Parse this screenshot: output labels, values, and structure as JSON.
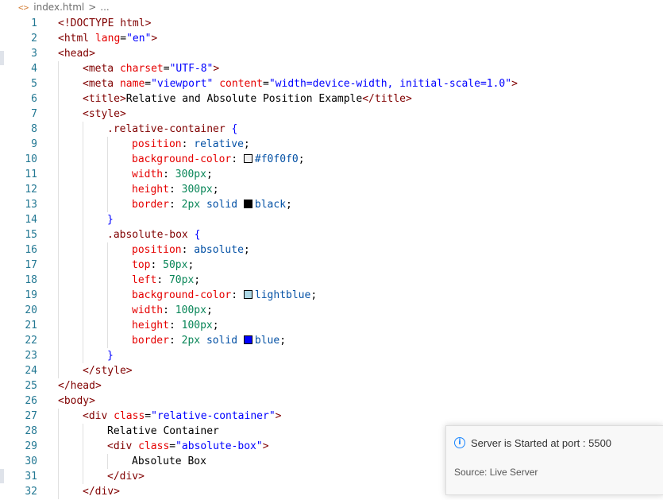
{
  "breadcrumb": {
    "icon": "<>",
    "file": "index.html",
    "separator": ">",
    "ellipsis": "..."
  },
  "lines": [
    {
      "n": "1",
      "i": 0,
      "s": [
        [
          "tag",
          "<!DOCTYPE html>"
        ]
      ]
    },
    {
      "n": "2",
      "i": 0,
      "s": [
        [
          "tag",
          "<html"
        ],
        [
          "attr",
          " lang"
        ],
        [
          "punct",
          "="
        ],
        [
          "str",
          "\"en\""
        ],
        [
          "tag",
          ">"
        ]
      ]
    },
    {
      "n": "3",
      "i": 0,
      "s": [
        [
          "tag",
          "<head>"
        ]
      ]
    },
    {
      "n": "4",
      "i": 1,
      "s": [
        [
          "tag",
          "<meta"
        ],
        [
          "attr",
          " charset"
        ],
        [
          "punct",
          "="
        ],
        [
          "str",
          "\"UTF-8\""
        ],
        [
          "tag",
          ">"
        ]
      ]
    },
    {
      "n": "5",
      "i": 1,
      "s": [
        [
          "tag",
          "<meta"
        ],
        [
          "attr",
          " name"
        ],
        [
          "punct",
          "="
        ],
        [
          "str",
          "\"viewport\""
        ],
        [
          "attr",
          " content"
        ],
        [
          "punct",
          "="
        ],
        [
          "str",
          "\"width=device-width, initial-scale=1.0\""
        ],
        [
          "tag",
          ">"
        ]
      ]
    },
    {
      "n": "6",
      "i": 1,
      "s": [
        [
          "tag",
          "<title>"
        ],
        [
          "punct",
          "Relative and Absolute Position Example"
        ],
        [
          "tag",
          "</title>"
        ]
      ]
    },
    {
      "n": "7",
      "i": 1,
      "s": [
        [
          "tag",
          "<style>"
        ]
      ]
    },
    {
      "n": "8",
      "i": 2,
      "s": [
        [
          "sel",
          ".relative-container"
        ],
        [
          "punct",
          " "
        ],
        [
          "str",
          "{"
        ]
      ]
    },
    {
      "n": "9",
      "i": 3,
      "s": [
        [
          "prop",
          "position"
        ],
        [
          "punct",
          ": "
        ],
        [
          "val",
          "relative"
        ],
        [
          "punct",
          ";"
        ]
      ]
    },
    {
      "n": "10",
      "i": 3,
      "s": [
        [
          "prop",
          "background-color"
        ],
        [
          "punct",
          ": "
        ],
        [
          "swatch",
          "#f0f0f0"
        ],
        [
          "val",
          "#f0f0f0"
        ],
        [
          "punct",
          ";"
        ]
      ]
    },
    {
      "n": "11",
      "i": 3,
      "s": [
        [
          "prop",
          "width"
        ],
        [
          "punct",
          ": "
        ],
        [
          "num",
          "300px"
        ],
        [
          "punct",
          ";"
        ]
      ]
    },
    {
      "n": "12",
      "i": 3,
      "s": [
        [
          "prop",
          "height"
        ],
        [
          "punct",
          ": "
        ],
        [
          "num",
          "300px"
        ],
        [
          "punct",
          ";"
        ]
      ]
    },
    {
      "n": "13",
      "i": 3,
      "s": [
        [
          "prop",
          "border"
        ],
        [
          "punct",
          ": "
        ],
        [
          "num",
          "2px"
        ],
        [
          "punct",
          " "
        ],
        [
          "val",
          "solid"
        ],
        [
          "punct",
          " "
        ],
        [
          "swatch",
          "#000000"
        ],
        [
          "val",
          "black"
        ],
        [
          "punct",
          ";"
        ]
      ]
    },
    {
      "n": "14",
      "i": 2,
      "s": [
        [
          "str",
          "}"
        ]
      ]
    },
    {
      "n": "15",
      "i": 2,
      "s": [
        [
          "sel",
          ".absolute-box"
        ],
        [
          "punct",
          " "
        ],
        [
          "str",
          "{"
        ]
      ]
    },
    {
      "n": "16",
      "i": 3,
      "s": [
        [
          "prop",
          "position"
        ],
        [
          "punct",
          ": "
        ],
        [
          "val",
          "absolute"
        ],
        [
          "punct",
          ";"
        ]
      ]
    },
    {
      "n": "17",
      "i": 3,
      "s": [
        [
          "prop",
          "top"
        ],
        [
          "punct",
          ": "
        ],
        [
          "num",
          "50px"
        ],
        [
          "punct",
          ";"
        ]
      ]
    },
    {
      "n": "18",
      "i": 3,
      "s": [
        [
          "prop",
          "left"
        ],
        [
          "punct",
          ": "
        ],
        [
          "num",
          "70px"
        ],
        [
          "punct",
          ";"
        ]
      ]
    },
    {
      "n": "19",
      "i": 3,
      "s": [
        [
          "prop",
          "background-color"
        ],
        [
          "punct",
          ": "
        ],
        [
          "swatch",
          "#add8e6"
        ],
        [
          "val",
          "lightblue"
        ],
        [
          "punct",
          ";"
        ]
      ]
    },
    {
      "n": "20",
      "i": 3,
      "s": [
        [
          "prop",
          "width"
        ],
        [
          "punct",
          ": "
        ],
        [
          "num",
          "100px"
        ],
        [
          "punct",
          ";"
        ]
      ]
    },
    {
      "n": "21",
      "i": 3,
      "s": [
        [
          "prop",
          "height"
        ],
        [
          "punct",
          ": "
        ],
        [
          "num",
          "100px"
        ],
        [
          "punct",
          ";"
        ]
      ]
    },
    {
      "n": "22",
      "i": 3,
      "s": [
        [
          "prop",
          "border"
        ],
        [
          "punct",
          ": "
        ],
        [
          "num",
          "2px"
        ],
        [
          "punct",
          " "
        ],
        [
          "val",
          "solid"
        ],
        [
          "punct",
          " "
        ],
        [
          "swatch",
          "#0000ff"
        ],
        [
          "val",
          "blue"
        ],
        [
          "punct",
          ";"
        ]
      ]
    },
    {
      "n": "23",
      "i": 2,
      "s": [
        [
          "str",
          "}"
        ]
      ]
    },
    {
      "n": "24",
      "i": 1,
      "s": [
        [
          "tag",
          "</style>"
        ]
      ]
    },
    {
      "n": "25",
      "i": 0,
      "s": [
        [
          "tag",
          "</head>"
        ]
      ]
    },
    {
      "n": "26",
      "i": 0,
      "s": [
        [
          "tag",
          "<body>"
        ]
      ]
    },
    {
      "n": "27",
      "i": 1,
      "s": [
        [
          "tag",
          "<div"
        ],
        [
          "attr",
          " class"
        ],
        [
          "punct",
          "="
        ],
        [
          "str",
          "\"relative-container\""
        ],
        [
          "tag",
          ">"
        ]
      ]
    },
    {
      "n": "28",
      "i": 2,
      "s": [
        [
          "punct",
          "Relative Container"
        ]
      ]
    },
    {
      "n": "29",
      "i": 2,
      "s": [
        [
          "tag",
          "<div"
        ],
        [
          "attr",
          " class"
        ],
        [
          "punct",
          "="
        ],
        [
          "str",
          "\"absolute-box\""
        ],
        [
          "tag",
          ">"
        ]
      ]
    },
    {
      "n": "30",
      "i": 3,
      "s": [
        [
          "punct",
          "Absolute Box"
        ]
      ]
    },
    {
      "n": "31",
      "i": 2,
      "s": [
        [
          "tag",
          "</div>"
        ]
      ]
    },
    {
      "n": "32",
      "i": 1,
      "s": [
        [
          "tag",
          "</div>"
        ]
      ]
    }
  ],
  "toast": {
    "message": "Server is Started at port : 5500",
    "source": "Source: Live Server",
    "icon": "info-icon",
    "accent": "#1a85ff"
  }
}
